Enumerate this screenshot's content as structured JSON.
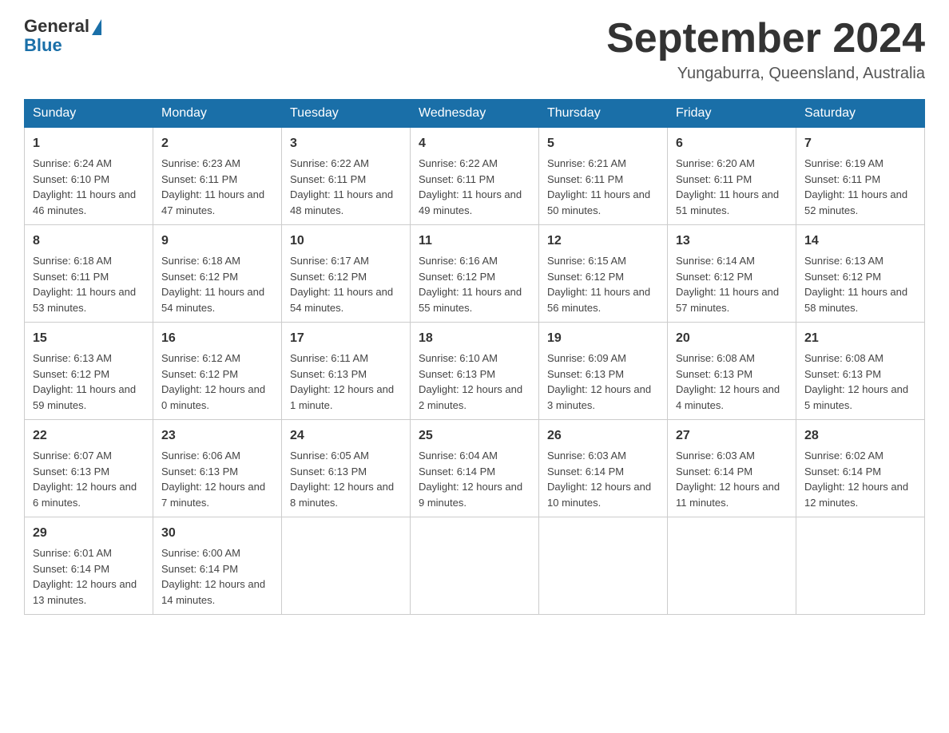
{
  "header": {
    "logo_general": "General",
    "logo_blue": "Blue",
    "month_title": "September 2024",
    "location": "Yungaburra, Queensland, Australia"
  },
  "days_of_week": [
    "Sunday",
    "Monday",
    "Tuesday",
    "Wednesday",
    "Thursday",
    "Friday",
    "Saturday"
  ],
  "weeks": [
    [
      {
        "day": "1",
        "sunrise": "6:24 AM",
        "sunset": "6:10 PM",
        "daylight": "11 hours and 46 minutes."
      },
      {
        "day": "2",
        "sunrise": "6:23 AM",
        "sunset": "6:11 PM",
        "daylight": "11 hours and 47 minutes."
      },
      {
        "day": "3",
        "sunrise": "6:22 AM",
        "sunset": "6:11 PM",
        "daylight": "11 hours and 48 minutes."
      },
      {
        "day": "4",
        "sunrise": "6:22 AM",
        "sunset": "6:11 PM",
        "daylight": "11 hours and 49 minutes."
      },
      {
        "day": "5",
        "sunrise": "6:21 AM",
        "sunset": "6:11 PM",
        "daylight": "11 hours and 50 minutes."
      },
      {
        "day": "6",
        "sunrise": "6:20 AM",
        "sunset": "6:11 PM",
        "daylight": "11 hours and 51 minutes."
      },
      {
        "day": "7",
        "sunrise": "6:19 AM",
        "sunset": "6:11 PM",
        "daylight": "11 hours and 52 minutes."
      }
    ],
    [
      {
        "day": "8",
        "sunrise": "6:18 AM",
        "sunset": "6:11 PM",
        "daylight": "11 hours and 53 minutes."
      },
      {
        "day": "9",
        "sunrise": "6:18 AM",
        "sunset": "6:12 PM",
        "daylight": "11 hours and 54 minutes."
      },
      {
        "day": "10",
        "sunrise": "6:17 AM",
        "sunset": "6:12 PM",
        "daylight": "11 hours and 54 minutes."
      },
      {
        "day": "11",
        "sunrise": "6:16 AM",
        "sunset": "6:12 PM",
        "daylight": "11 hours and 55 minutes."
      },
      {
        "day": "12",
        "sunrise": "6:15 AM",
        "sunset": "6:12 PM",
        "daylight": "11 hours and 56 minutes."
      },
      {
        "day": "13",
        "sunrise": "6:14 AM",
        "sunset": "6:12 PM",
        "daylight": "11 hours and 57 minutes."
      },
      {
        "day": "14",
        "sunrise": "6:13 AM",
        "sunset": "6:12 PM",
        "daylight": "11 hours and 58 minutes."
      }
    ],
    [
      {
        "day": "15",
        "sunrise": "6:13 AM",
        "sunset": "6:12 PM",
        "daylight": "11 hours and 59 minutes."
      },
      {
        "day": "16",
        "sunrise": "6:12 AM",
        "sunset": "6:12 PM",
        "daylight": "12 hours and 0 minutes."
      },
      {
        "day": "17",
        "sunrise": "6:11 AM",
        "sunset": "6:13 PM",
        "daylight": "12 hours and 1 minute."
      },
      {
        "day": "18",
        "sunrise": "6:10 AM",
        "sunset": "6:13 PM",
        "daylight": "12 hours and 2 minutes."
      },
      {
        "day": "19",
        "sunrise": "6:09 AM",
        "sunset": "6:13 PM",
        "daylight": "12 hours and 3 minutes."
      },
      {
        "day": "20",
        "sunrise": "6:08 AM",
        "sunset": "6:13 PM",
        "daylight": "12 hours and 4 minutes."
      },
      {
        "day": "21",
        "sunrise": "6:08 AM",
        "sunset": "6:13 PM",
        "daylight": "12 hours and 5 minutes."
      }
    ],
    [
      {
        "day": "22",
        "sunrise": "6:07 AM",
        "sunset": "6:13 PM",
        "daylight": "12 hours and 6 minutes."
      },
      {
        "day": "23",
        "sunrise": "6:06 AM",
        "sunset": "6:13 PM",
        "daylight": "12 hours and 7 minutes."
      },
      {
        "day": "24",
        "sunrise": "6:05 AM",
        "sunset": "6:13 PM",
        "daylight": "12 hours and 8 minutes."
      },
      {
        "day": "25",
        "sunrise": "6:04 AM",
        "sunset": "6:14 PM",
        "daylight": "12 hours and 9 minutes."
      },
      {
        "day": "26",
        "sunrise": "6:03 AM",
        "sunset": "6:14 PM",
        "daylight": "12 hours and 10 minutes."
      },
      {
        "day": "27",
        "sunrise": "6:03 AM",
        "sunset": "6:14 PM",
        "daylight": "12 hours and 11 minutes."
      },
      {
        "day": "28",
        "sunrise": "6:02 AM",
        "sunset": "6:14 PM",
        "daylight": "12 hours and 12 minutes."
      }
    ],
    [
      {
        "day": "29",
        "sunrise": "6:01 AM",
        "sunset": "6:14 PM",
        "daylight": "12 hours and 13 minutes."
      },
      {
        "day": "30",
        "sunrise": "6:00 AM",
        "sunset": "6:14 PM",
        "daylight": "12 hours and 14 minutes."
      },
      null,
      null,
      null,
      null,
      null
    ]
  ],
  "labels": {
    "sunrise": "Sunrise:",
    "sunset": "Sunset:",
    "daylight": "Daylight:"
  }
}
